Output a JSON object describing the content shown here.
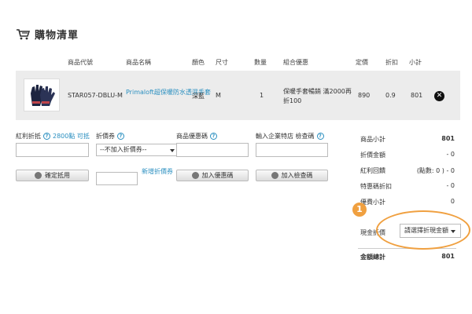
{
  "page": {
    "title": "購物清單"
  },
  "table": {
    "headers": [
      "商品代號",
      "商品名稱",
      "顏色",
      "尺寸",
      "數量",
      "組合優惠",
      "定價",
      "折扣",
      "小計"
    ],
    "row": {
      "code": "STAR057-DBLU-M",
      "name": "Primaloft超保暖防水透濕手套",
      "color": "深藍",
      "size": "M",
      "qty": "1",
      "promo": "保暖手套暢銷 滿2000再折100",
      "price": "890",
      "discount": "0.9",
      "subtotal": "801"
    }
  },
  "form": {
    "bonus_label": "紅利折抵",
    "bonus_points": "2800點 可抵",
    "voucher_label": "折價券",
    "voucher_select": "--不加入折價券--",
    "coupon_label": "商品優惠碼",
    "enterprise_label": "輸入企業特店 檢查碼",
    "confirm_bonus_btn": "確定抵用",
    "new_voucher_link": "新增折價券",
    "add_coupon_btn": "加入優惠碼",
    "add_check_btn": "加入檢查碼"
  },
  "summary": {
    "items": [
      {
        "label": "商品小計",
        "value": "801",
        "bold": true
      },
      {
        "label": "折價金額",
        "value": "- 0"
      },
      {
        "label": "紅利回饋",
        "value": "(點數: 0 ) - 0"
      },
      {
        "label": "特惠碼折扣",
        "value": "- 0"
      },
      {
        "label": "優費小計",
        "value": "0"
      }
    ],
    "cash_label": "現金折價",
    "cash_select": "請選擇折現金額",
    "total_label": "金額總計",
    "total_value": "801"
  },
  "callout": {
    "number": "1",
    "color": "#f0a040"
  },
  "colors": {
    "link": "#2a8fc0",
    "row_band": "#ececec"
  }
}
